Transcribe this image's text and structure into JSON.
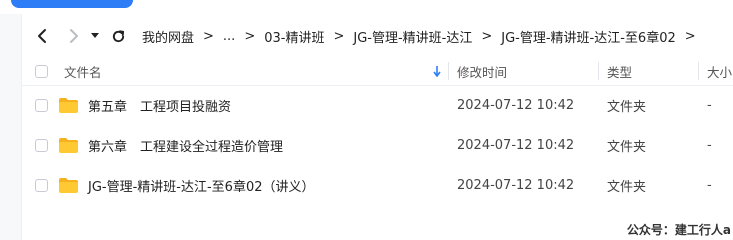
{
  "navigation": {
    "breadcrumbs": [
      "我的网盘",
      "...",
      "03-精讲班",
      "JG-管理-精讲班-达江",
      "JG-管理-精讲班-达江-至6章02"
    ]
  },
  "table": {
    "columns": {
      "name": "文件名",
      "modified": "修改时间",
      "type": "类型",
      "size": "大小"
    },
    "rows": [
      {
        "name": "第五章　工程项目投融资",
        "modified": "2024-07-12 10:42",
        "type": "文件夹",
        "size": "-"
      },
      {
        "name": "第六章　工程建设全过程造价管理",
        "modified": "2024-07-12 10:42",
        "type": "文件夹",
        "size": "-"
      },
      {
        "name": "JG-管理-精讲班-达江-至6章02（讲义）",
        "modified": "2024-07-12 10:42",
        "type": "文件夹",
        "size": "-"
      }
    ]
  },
  "watermark": "公众号：建工行人a",
  "colors": {
    "accent": "#2d7df6",
    "folder": "#ffc933",
    "folder_tab": "#f5b21e"
  }
}
